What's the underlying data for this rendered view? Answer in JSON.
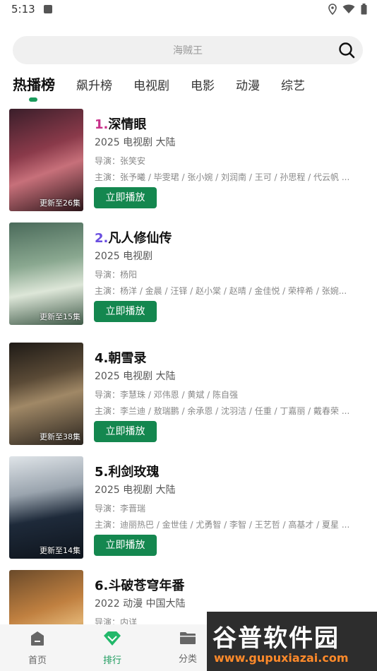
{
  "status_bar": {
    "time": "5:13"
  },
  "search": {
    "placeholder": "海贼王"
  },
  "tabs": [
    {
      "label": "热播榜",
      "active": true
    },
    {
      "label": "飙升榜"
    },
    {
      "label": "电视剧"
    },
    {
      "label": "电影"
    },
    {
      "label": "动漫"
    },
    {
      "label": "综艺"
    }
  ],
  "items": [
    {
      "rank": "1.",
      "rank_color": "#c8318a",
      "title": "深情眼",
      "meta": "2025  电视剧  大陆",
      "director": "导演：张笑安",
      "cast": "主演：张予曦 / 毕雯珺 / 张小婉 / 刘润南 / 王可 / 孙思程 / 代云帆 ...",
      "update": "更新至26集",
      "play": "立即播放"
    },
    {
      "rank": "2.",
      "rank_color": "#6a4ee0",
      "title": "凡人修仙传",
      "meta": "2025  电视剧",
      "director": "导演：杨阳",
      "cast": "主演：杨洋 / 金晨 / 汪铎 / 赵小棠 / 赵晴 / 金佳悦 / 荣梓希 / 张婉...",
      "update": "更新至15集",
      "play": "立即播放"
    },
    {
      "rank": "4.",
      "rank_color": "#111111",
      "title": "朝雪录",
      "meta": "2025  电视剧  大陆",
      "director": "导演：李慧珠 / 邓伟恩 / 黄斌 / 陈自强",
      "cast": "主演：李兰迪 / 敖瑞鹏 / 余承恩 / 沈羽洁 / 任重 / 丁嘉丽 / 戴春荣 ...",
      "update": "更新至38集",
      "play": "立即播放"
    },
    {
      "rank": "5.",
      "rank_color": "#111111",
      "title": "利剑玫瑰",
      "meta": "2025  电视剧  大陆",
      "director": "导演：李晋瑞",
      "cast": "主演：迪丽热巴 / 金世佳 / 尤勇智 / 李智 / 王艺哲 / 高基才 / 夏星 ...",
      "update": "更新至14集",
      "play": "立即播放"
    },
    {
      "rank": "6.",
      "rank_color": "#111111",
      "title": "斗破苍穹年番",
      "meta": "2022  动漫  中国大陆",
      "director": "导演：内详",
      "cast": "",
      "update": "",
      "play": ""
    }
  ],
  "bottom_nav": [
    {
      "label": "首页",
      "icon": "home-icon"
    },
    {
      "label": "排行",
      "icon": "diamond-icon",
      "active": true
    },
    {
      "label": "分类",
      "icon": "folder-icon"
    }
  ],
  "watermark": {
    "text": "谷普软件园",
    "url": "www.gupuxiazai.com"
  }
}
